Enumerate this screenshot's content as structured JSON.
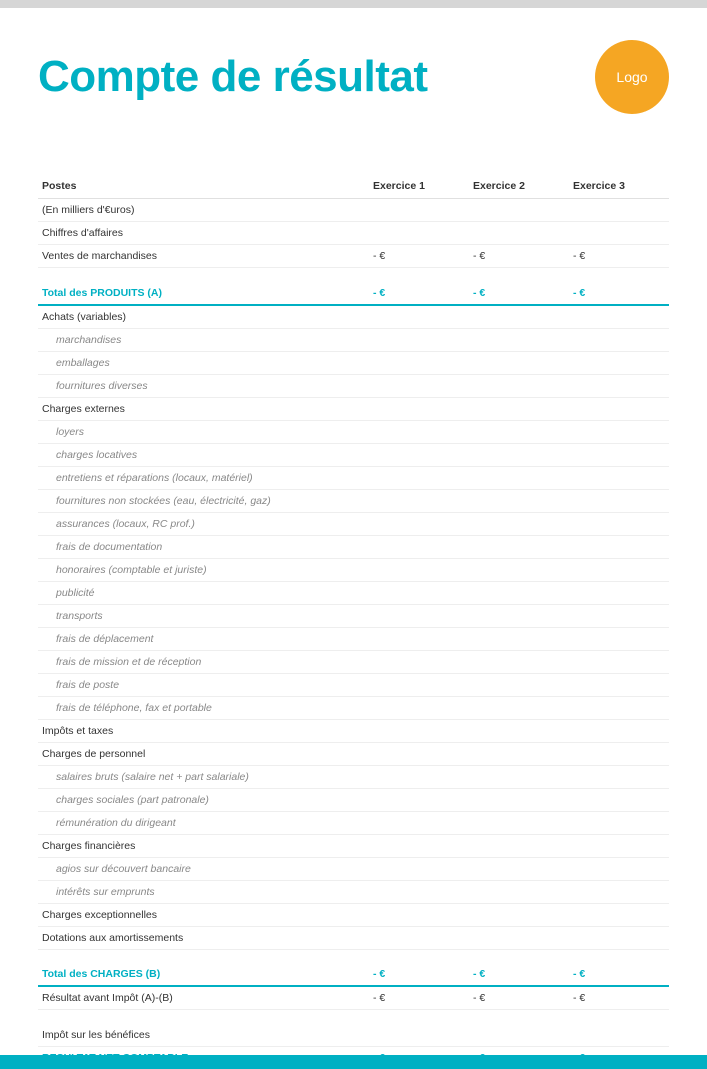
{
  "title": "Compte de résultat",
  "logo_text": "Logo",
  "columns": {
    "postes": "Postes",
    "ex1": "Exercice 1",
    "ex2": "Exercice 2",
    "ex3": "Exercice 3"
  },
  "rows": [
    {
      "label": "(En milliers d'€uros)",
      "type": "section"
    },
    {
      "label": "Chiffres d'affaires",
      "type": "section"
    },
    {
      "label": "Ventes de marchandises",
      "type": "section",
      "v1": "- €",
      "v2": "- €",
      "v3": "- €"
    },
    {
      "type": "spacer"
    },
    {
      "label": "Total des PRODUITS (A)",
      "type": "total",
      "v1": "- €",
      "v2": "- €",
      "v3": "- €"
    },
    {
      "label": "Achats (variables)",
      "type": "section"
    },
    {
      "label": "marchandises",
      "type": "sub"
    },
    {
      "label": "emballages",
      "type": "sub"
    },
    {
      "label": "fournitures diverses",
      "type": "sub"
    },
    {
      "label": "Charges externes",
      "type": "section"
    },
    {
      "label": "loyers",
      "type": "sub"
    },
    {
      "label": "charges locatives",
      "type": "sub"
    },
    {
      "label": "entretiens et réparations (locaux, matériel)",
      "type": "sub"
    },
    {
      "label": "fournitures non stockées (eau, électricité, gaz)",
      "type": "sub"
    },
    {
      "label": "assurances (locaux, RC prof.)",
      "type": "sub"
    },
    {
      "label": "frais de documentation",
      "type": "sub"
    },
    {
      "label": "honoraires (comptable et juriste)",
      "type": "sub"
    },
    {
      "label": "publicité",
      "type": "sub"
    },
    {
      "label": "transports",
      "type": "sub"
    },
    {
      "label": "frais de déplacement",
      "type": "sub"
    },
    {
      "label": "frais de mission et de réception",
      "type": "sub"
    },
    {
      "label": "frais de poste",
      "type": "sub"
    },
    {
      "label": "frais de téléphone, fax et portable",
      "type": "sub"
    },
    {
      "label": "Impôts et taxes",
      "type": "section"
    },
    {
      "label": "Charges de personnel",
      "type": "section"
    },
    {
      "label": "salaires bruts (salaire net + part salariale)",
      "type": "sub"
    },
    {
      "label": "charges sociales (part patronale)",
      "type": "sub"
    },
    {
      "label": "rémunération du dirigeant",
      "type": "sub"
    },
    {
      "label": "Charges financières",
      "type": "section"
    },
    {
      "label": "agios sur découvert bancaire",
      "type": "sub"
    },
    {
      "label": "intérêts sur emprunts",
      "type": "sub"
    },
    {
      "label": "Charges exceptionnelles",
      "type": "section"
    },
    {
      "label": "Dotations aux amortissements",
      "type": "section"
    },
    {
      "type": "spacer"
    },
    {
      "label": "Total des CHARGES (B)",
      "type": "total",
      "v1": "- €",
      "v2": "- €",
      "v3": "- €"
    },
    {
      "label": "Résultat avant Impôt (A)-(B)",
      "type": "result",
      "v1": "- €",
      "v2": "- €",
      "v3": "- €"
    },
    {
      "type": "spacer"
    },
    {
      "label": "Impôt sur les bénéfices",
      "type": "section"
    },
    {
      "label": "RESULTAT NET COMPTABLE",
      "type": "final",
      "v1": "- €",
      "v2": "- €",
      "v3": "- €"
    }
  ]
}
